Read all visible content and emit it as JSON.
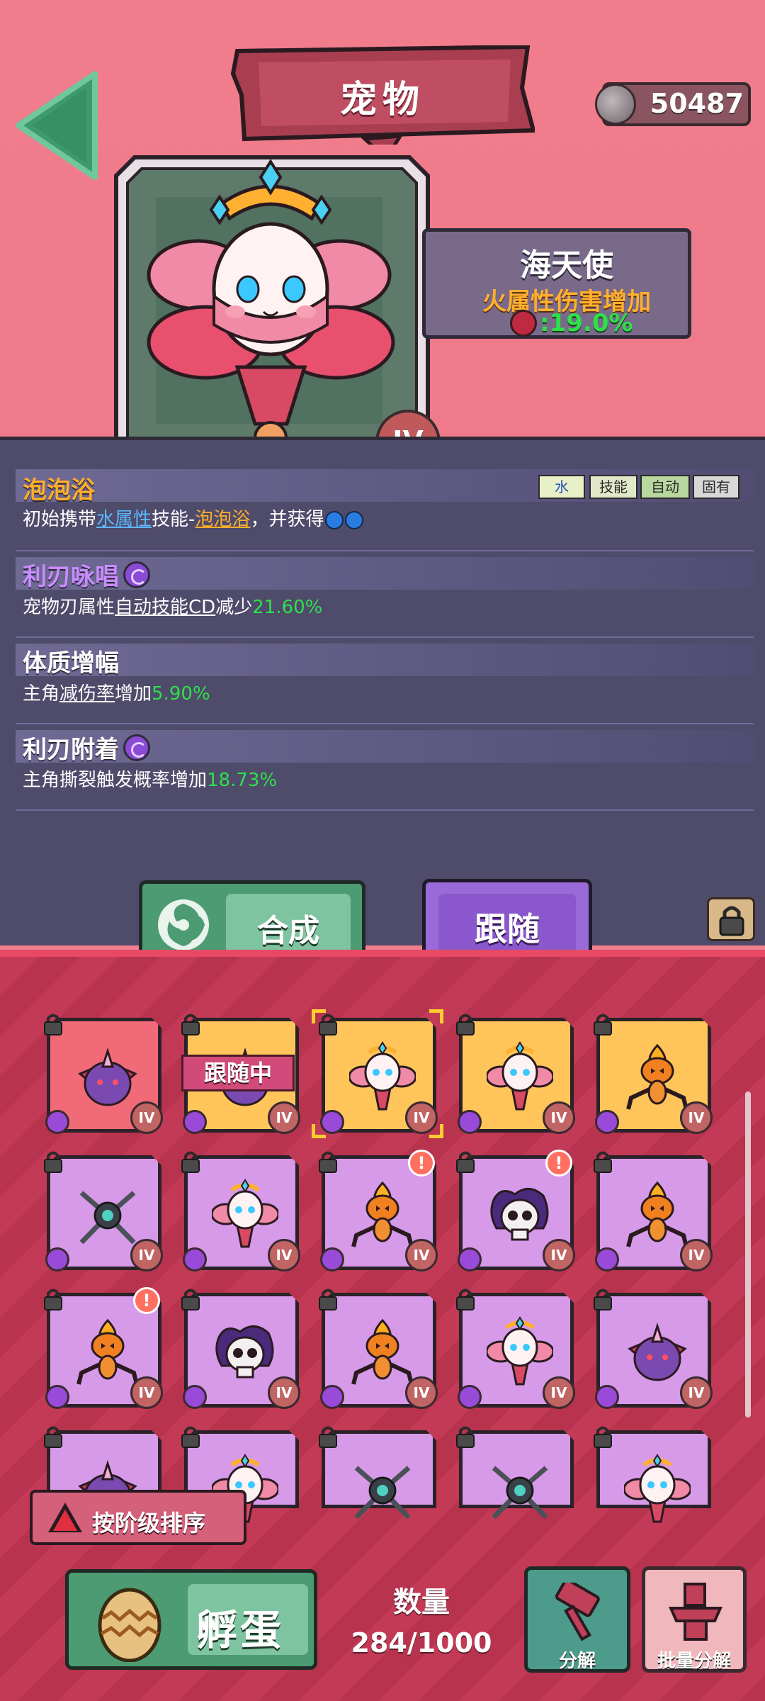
{
  "header": {
    "title": "宠物",
    "coins": "50487",
    "back_icon": "back-arrow-icon",
    "coin_icon": "gear-coin-icon"
  },
  "pet": {
    "name": "海天使",
    "attribute": "火属性伤害增加",
    "bonus_icon": "fire-icon",
    "bonus_value": ":19.0%",
    "rank": "IV"
  },
  "tags": [
    "水",
    "技能",
    "自动",
    "固有"
  ],
  "skills": [
    {
      "title": "泡泡浴",
      "desc_parts": [
        "初始携带",
        "水属性",
        "技能-",
        "泡泡浴",
        "，并获得"
      ],
      "icons": [
        "water-drop-icon",
        "water-drop-icon"
      ]
    },
    {
      "title": "利刃咏唱",
      "icon": "swirl-icon",
      "desc_parts": [
        "宠物刃属性",
        "自动技能CD",
        "减少",
        "21.60%"
      ]
    },
    {
      "title": "体质增幅",
      "desc_parts": [
        "主角",
        "减伤率",
        "增加",
        "5.90%"
      ]
    },
    {
      "title": "利刃附着",
      "icon": "swirl-icon",
      "desc_parts": [
        "主角撕裂触发概率增加",
        "18.73%"
      ]
    }
  ],
  "buttons": {
    "compose": "合成",
    "follow": "跟随",
    "sort": "按阶级排序",
    "hatch": "孵蛋",
    "decompose": "分解",
    "batch_decompose": "批量分解"
  },
  "inventory": {
    "count_label": "数量",
    "count_value": "284/1000",
    "follow_badge": "跟随中",
    "rank_label": "IV",
    "alert_mark": "!",
    "cards": [
      {
        "type": "horned-blob",
        "bg": "red"
      },
      {
        "type": "horned-blob",
        "bg": "orange",
        "following": true
      },
      {
        "type": "angel",
        "bg": "orange",
        "selected": true
      },
      {
        "type": "angel",
        "bg": "orange"
      },
      {
        "type": "pumpkin-spider",
        "bg": "orange"
      },
      {
        "type": "drone",
        "bg": "purple"
      },
      {
        "type": "angel",
        "bg": "purple"
      },
      {
        "type": "pumpkin-spider",
        "bg": "purple",
        "alert": true
      },
      {
        "type": "skull-ghost",
        "bg": "purple",
        "alert": true
      },
      {
        "type": "pumpkin-spider",
        "bg": "purple"
      },
      {
        "type": "pumpkin-spider",
        "bg": "purple",
        "alert": true
      },
      {
        "type": "skull-ghost",
        "bg": "purple"
      },
      {
        "type": "pumpkin-spider",
        "bg": "purple"
      },
      {
        "type": "angel",
        "bg": "purple"
      },
      {
        "type": "horned-blob",
        "bg": "purple"
      },
      {
        "type": "horned-blob",
        "bg": "purple"
      },
      {
        "type": "angel",
        "bg": "purple"
      },
      {
        "type": "drone",
        "bg": "purple"
      },
      {
        "type": "drone",
        "bg": "purple"
      },
      {
        "type": "angel",
        "bg": "purple"
      }
    ]
  }
}
